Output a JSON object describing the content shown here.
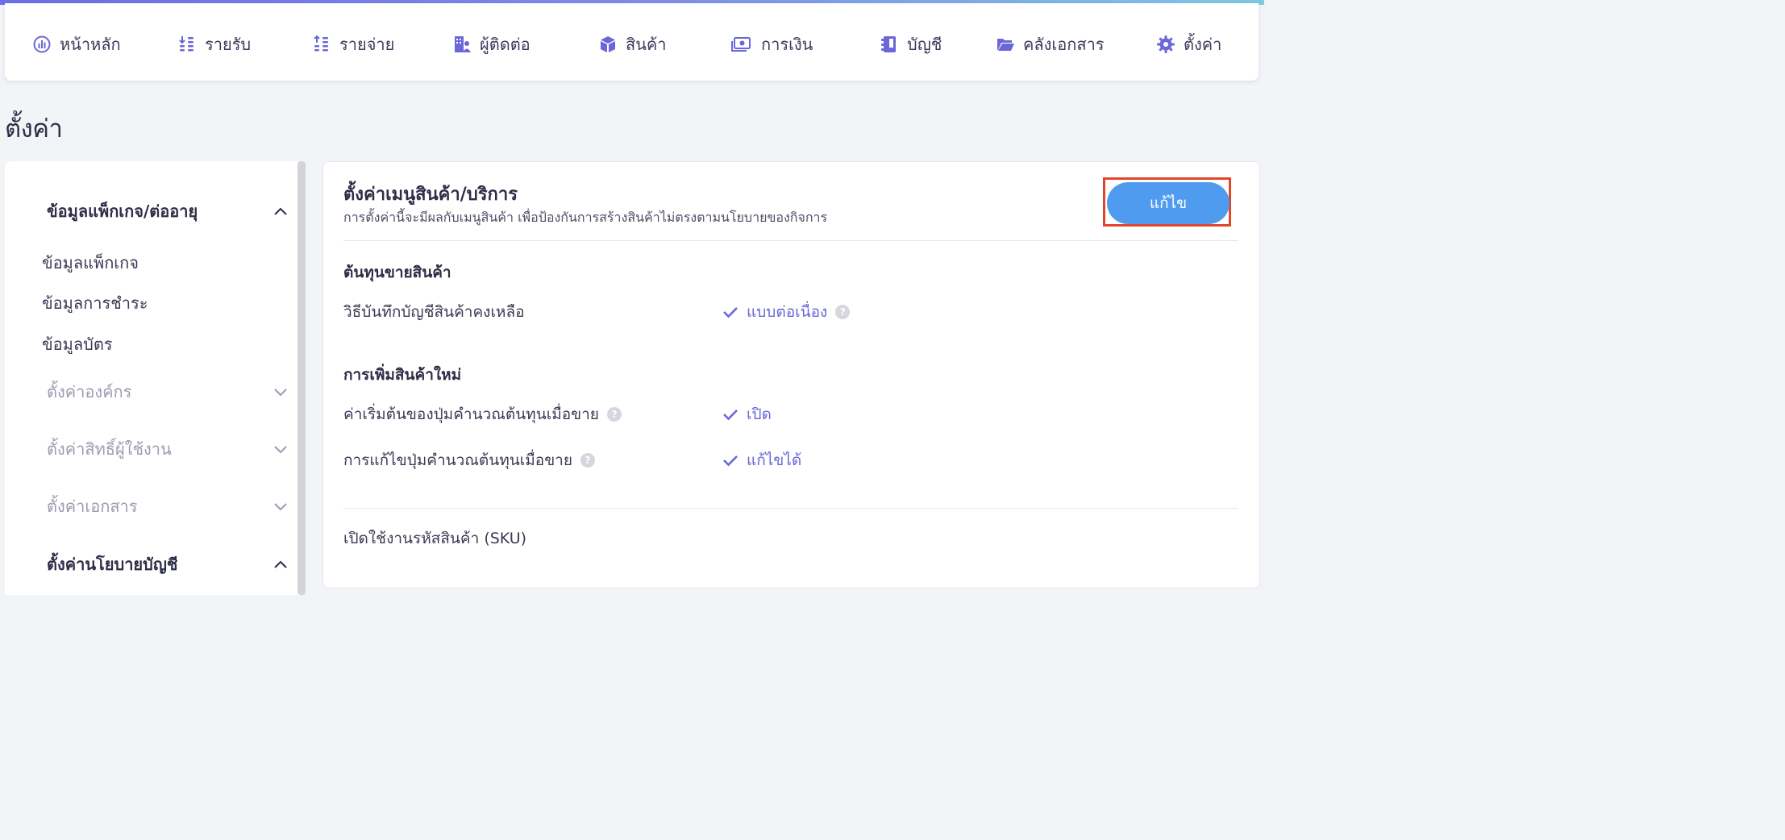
{
  "nav": {
    "items": [
      {
        "label": "หน้าหลัก",
        "icon": "dashboard-icon"
      },
      {
        "label": "รายรับ",
        "icon": "income-icon"
      },
      {
        "label": "รายจ่าย",
        "icon": "expense-icon"
      },
      {
        "label": "ผู้ติดต่อ",
        "icon": "contacts-icon"
      },
      {
        "label": "สินค้า",
        "icon": "product-box-icon"
      },
      {
        "label": "การเงิน",
        "icon": "money-icon"
      },
      {
        "label": "บัญชี",
        "icon": "accounting-book-icon"
      },
      {
        "label": "คลังเอกสาร",
        "icon": "folder-icon"
      },
      {
        "label": "ตั้งค่า",
        "icon": "gear-icon"
      }
    ]
  },
  "page": {
    "title": "ตั้งค่า"
  },
  "sidebar": {
    "sections": [
      {
        "label": "ข้อมูลแพ็กเกจ/ต่ออายุ",
        "expanded": true,
        "items": [
          "ข้อมูลแพ็กเกจ",
          "ข้อมูลการชำระ",
          "ข้อมูลบัตร"
        ]
      },
      {
        "label": "ตั้งค่าองค์กร",
        "expanded": false
      },
      {
        "label": "ตั้งค่าสิทธิ์ผู้ใช้งาน",
        "expanded": false
      },
      {
        "label": "ตั้งค่าเอกสาร",
        "expanded": false
      },
      {
        "label": "ตั้งค่านโยบายบัญชี",
        "expanded": true
      }
    ]
  },
  "panel": {
    "title": "ตั้งค่าเมนูสินค้า/บริการ",
    "description": "การตั้งค่านี้จะมีผลกับเมนูสินค้า เพื่อป้องกันการสร้างสินค้าไม่ตรงตามนโยบายของกิจการ",
    "edit_label": "แก้ไข",
    "groups": [
      {
        "title": "ต้นทุนขายสินค้า",
        "rows": [
          {
            "label": "วิธีบันทึกบัญชีสินค้าคงเหลือ",
            "value": "แบบต่อเนื่อง",
            "help": "?"
          }
        ]
      },
      {
        "title": "การเพิ่มสินค้าใหม่",
        "rows": [
          {
            "label": "ค่าเริ่มต้นของปุ่มคำนวณต้นทุนเมื่อขาย",
            "value": "เปิด",
            "help": "?"
          },
          {
            "label": "การแก้ไขปุ่มคำนวณต้นทุนเมื่อขาย",
            "value": "แก้ไขได้",
            "help": "?"
          }
        ]
      }
    ],
    "sku_label": "เปิดใช้งานรหัสสินค้า (SKU)"
  },
  "colors": {
    "accent": "#6a67d6",
    "button": "#4f9bef",
    "highlight": "#e24528"
  }
}
